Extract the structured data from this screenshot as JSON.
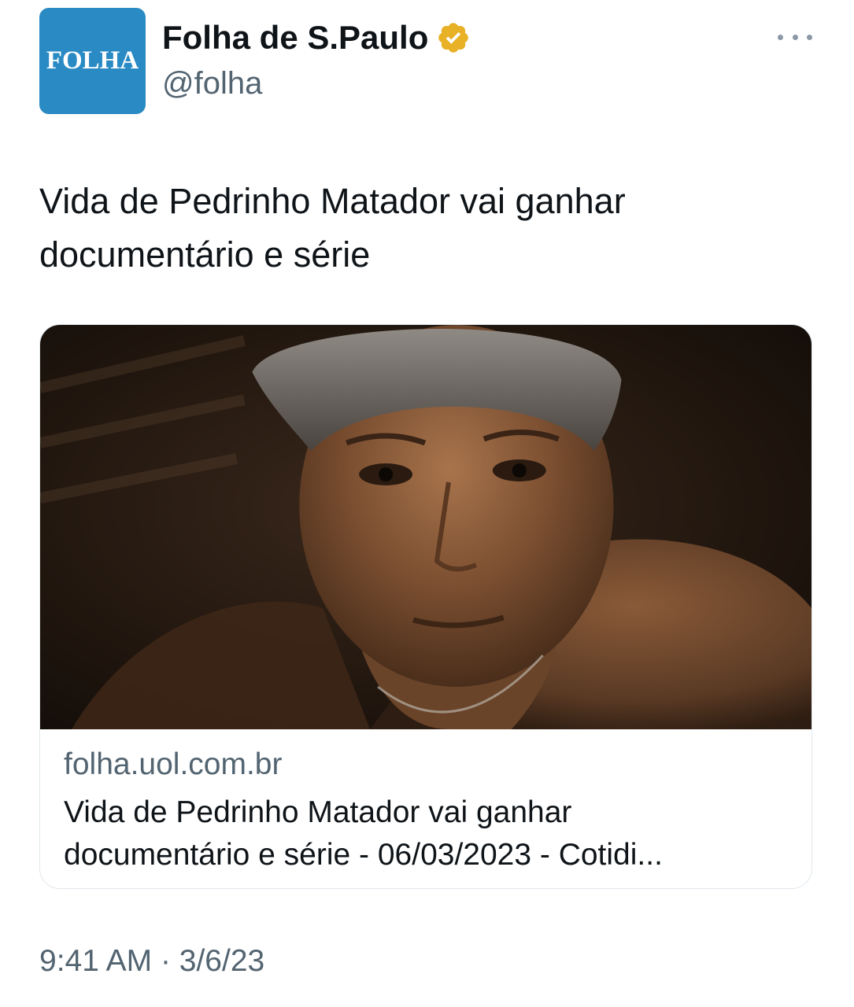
{
  "tweet": {
    "avatar_text": "FOLHA",
    "display_name": "Folha de S.Paulo",
    "handle": "@folha",
    "text_line1": "Vida de Pedrinho Matador vai ganhar",
    "text_line2": "documentário e série",
    "card": {
      "domain": "folha.uol.com.br",
      "title_line1": "Vida de Pedrinho Matador vai ganhar",
      "title_line2": "documentário e série - 06/03/2023 - Cotidi..."
    },
    "time": "9:41 AM",
    "separator": "·",
    "date": "3/6/23"
  },
  "icons": {
    "verified": "verified-badge-icon",
    "more": "more-horizontal-icon"
  },
  "colors": {
    "avatar_bg": "#2a8ac4",
    "verified_gold": "#e8b126",
    "secondary_text": "#536471"
  }
}
